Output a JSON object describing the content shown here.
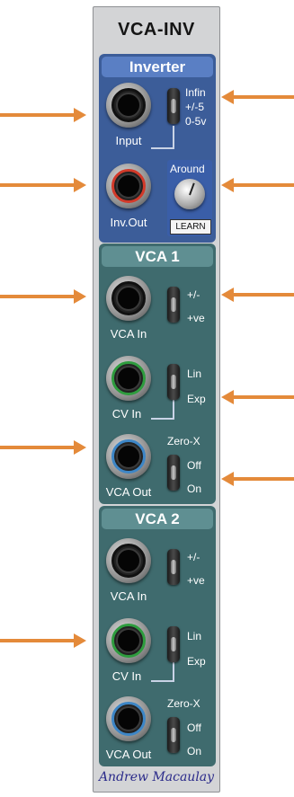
{
  "module": {
    "title": "VCA-INV",
    "author": "Andrew Macaulay"
  },
  "inverter": {
    "title": "Inverter",
    "input_label": "Input",
    "output_label": "Inv.Out",
    "range_switch": {
      "options": [
        "Infin",
        "+/-5",
        "0-5v"
      ]
    },
    "around_label": "Around",
    "learn_label": "LEARN"
  },
  "vca1": {
    "title": "VCA 1",
    "vca_in_label": "VCA In",
    "cv_in_label": "CV In",
    "vca_out_label": "VCA Out",
    "polarity_switch": {
      "top": "+/-",
      "bottom": "+ve"
    },
    "response_switch": {
      "top": "Lin",
      "bottom": "Exp"
    },
    "zerox_switch": {
      "title": "Zero-X",
      "top": "Off",
      "bottom": "On"
    }
  },
  "vca2": {
    "title": "VCA 2",
    "vca_in_label": "VCA In",
    "cv_in_label": "CV In",
    "vca_out_label": "VCA Out",
    "polarity_switch": {
      "top": "+/-",
      "bottom": "+ve"
    },
    "response_switch": {
      "top": "Lin",
      "bottom": "Exp"
    },
    "zerox_switch": {
      "title": "Zero-X",
      "top": "Off",
      "bottom": "On"
    }
  },
  "colors": {
    "arrow": "#e48a3a",
    "inverter_section": "#3c5d99",
    "vca_section": "#3f6b6e",
    "panel": "#d3d4d6"
  }
}
